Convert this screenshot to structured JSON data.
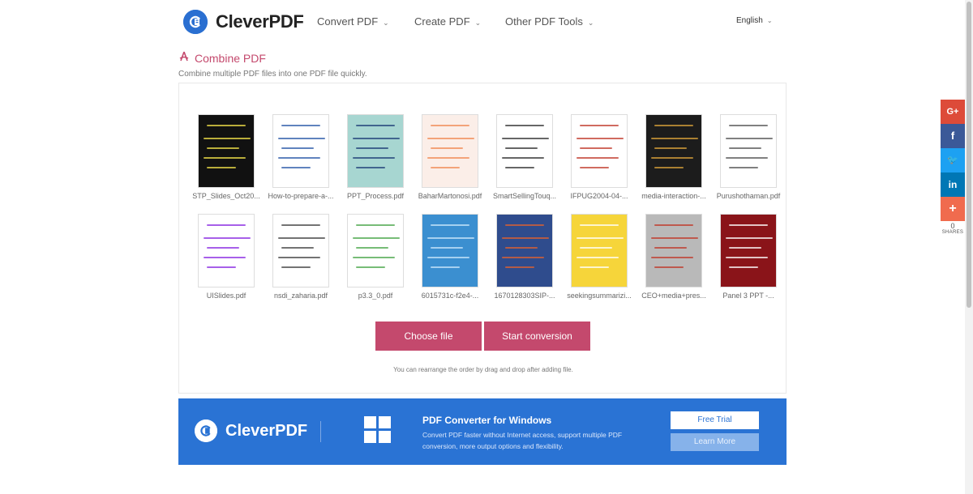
{
  "brand": {
    "name": "CleverPDF",
    "color": "#2a6fd1"
  },
  "nav": {
    "items": [
      {
        "label": "Convert PDF",
        "icon": "chevron-down-icon"
      },
      {
        "label": "Create PDF",
        "icon": "chevron-down-icon"
      },
      {
        "label": "Other PDF Tools",
        "icon": "chevron-down-icon"
      }
    ],
    "language": "English"
  },
  "page": {
    "title": "Combine PDF",
    "subtitle": "Combine multiple PDF files into one PDF file quickly.",
    "accent": "#c4496d",
    "title_icon": "acrobat-icon"
  },
  "files": [
    {
      "name": "STP_Slides_Oct20...",
      "thumb_bg": "#111111",
      "accent": "#f2e24a"
    },
    {
      "name": "How-to-prepare-a-...",
      "thumb_bg": "#ffffff",
      "accent": "#2b5aa8"
    },
    {
      "name": "PPT_Process.pdf",
      "thumb_bg": "#a7d6d1",
      "accent": "#1f3f77"
    },
    {
      "name": "BaharMartonosi.pdf",
      "thumb_bg": "#fbeee8",
      "accent": "#f08a54"
    },
    {
      "name": "SmartSellingTouq...",
      "thumb_bg": "#ffffff",
      "accent": "#333333"
    },
    {
      "name": "IFPUG2004-04-...",
      "thumb_bg": "#ffffff",
      "accent": "#c0392b"
    },
    {
      "name": "media-interaction-...",
      "thumb_bg": "#1c1c1c",
      "accent": "#d9a13a"
    },
    {
      "name": "Purushothaman.pdf",
      "thumb_bg": "#ffffff",
      "accent": "#555555"
    },
    {
      "name": "UISlides.pdf",
      "thumb_bg": "#ffffff",
      "accent": "#8a2be2"
    },
    {
      "name": "nsdi_zaharia.pdf",
      "thumb_bg": "#ffffff",
      "accent": "#444444"
    },
    {
      "name": "p3.3_0.pdf",
      "thumb_bg": "#ffffff",
      "accent": "#4aa54a"
    },
    {
      "name": "6015731c-f2e4-...",
      "thumb_bg": "#3b8fd0",
      "accent": "#c9e6fb"
    },
    {
      "name": "1670128303SIP-...",
      "thumb_bg": "#2f4c8d",
      "accent": "#e06030"
    },
    {
      "name": "seekingsummarizi...",
      "thumb_bg": "#f6d53a",
      "accent": "#ffffff"
    },
    {
      "name": "CEO+media+pres...",
      "thumb_bg": "#b9b9b9",
      "accent": "#c0392b"
    },
    {
      "name": "Panel 3 PPT -...",
      "thumb_bg": "#8a1419",
      "accent": "#ffffff"
    }
  ],
  "actions": {
    "choose_file": "Choose file",
    "start_conversion": "Start conversion",
    "hint": "You can rearrange the order by drag and drop after adding file."
  },
  "banner": {
    "logo_text": "CleverPDF",
    "title": "PDF Converter for Windows",
    "description": "Convert PDF faster without Internet access, support multiple PDF conversion, more output options and flexibility.",
    "free_trial": "Free Trial",
    "learn_more": "Learn More",
    "bg": "#2a73d4",
    "icon": "windows-icon"
  },
  "social": {
    "buttons": [
      {
        "icon": "google-plus-icon",
        "glyph": "G+",
        "color": "#dd4b39"
      },
      {
        "icon": "facebook-icon",
        "glyph": "f",
        "color": "#3b5998"
      },
      {
        "icon": "twitter-icon",
        "glyph": "🐦",
        "color": "#1da1f2"
      },
      {
        "icon": "linkedin-icon",
        "glyph": "in",
        "color": "#0077b5"
      },
      {
        "icon": "share-plus-icon",
        "glyph": "+",
        "color": "#f06b4e"
      }
    ],
    "count": "0",
    "label": "SHARES"
  }
}
